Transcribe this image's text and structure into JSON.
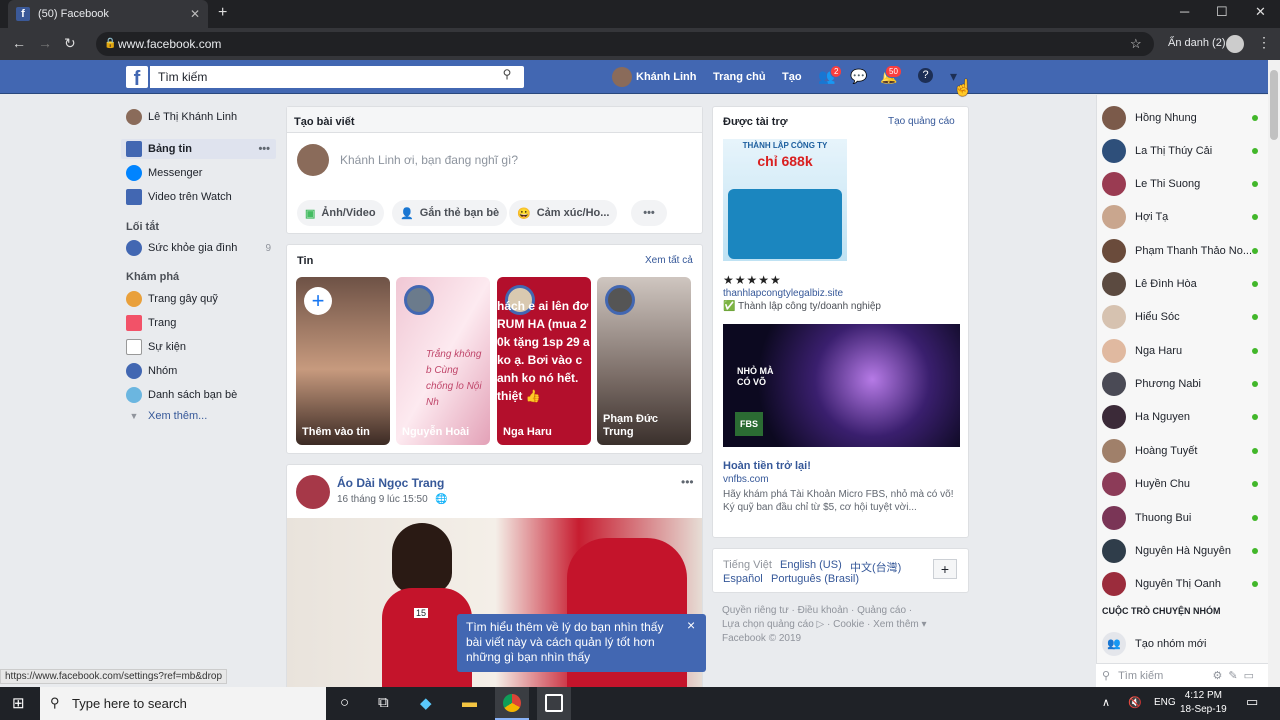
{
  "browser": {
    "tab_title": "(50) Facebook",
    "url": "www.facebook.com",
    "incognito_label": "Ẩn danh (2)",
    "status_url": "https://www.facebook.com/settings?ref=mb&drop"
  },
  "fb_header": {
    "search_placeholder": "Tìm kiếm",
    "user_name": "Khánh Linh",
    "home": "Trang chủ",
    "create": "Tạo",
    "friend_badge": "2",
    "notif_badge": "50"
  },
  "left_nav": {
    "profile": "Lê Thị Khánh Linh",
    "items": [
      "Bảng tin",
      "Messenger",
      "Video trên Watch"
    ],
    "shortcuts_title": "Lối tắt",
    "shortcut": "Sức khỏe gia đình",
    "shortcut_count": "9",
    "explore_title": "Khám phá",
    "explore": [
      "Trang gây quỹ",
      "Trang",
      "Sự kiện",
      "Nhóm",
      "Danh sách bạn bè"
    ],
    "see_more": "Xem thêm..."
  },
  "composer": {
    "title": "Tạo bài viết",
    "placeholder": "Khánh Linh ơi, bạn đang nghĩ gì?",
    "photo": "Ảnh/Video",
    "tag": "Gắn thẻ bạn bè",
    "feeling": "Cảm xúc/Ho...",
    "more": "•••"
  },
  "stories": {
    "title": "Tin",
    "see_all": "Xem tất cả",
    "items": [
      "Thêm vào tin",
      "Nguyễn Hoài",
      "Nga Haru",
      "Phạm Đức Trung"
    ],
    "story2_text": "Trắng không b Cùng chống lo Nội Nh",
    "story3_text": "hách e ai lên đơ RUM HA (mua 2 0k tặng 1sp 29 a ko ạ. Bơi vào c anh ko nó hết. thiệt 👍"
  },
  "post": {
    "author": "Áo Dài Ngọc Trang",
    "time": "16 tháng 9 lúc 15:50",
    "more": "•••",
    "tag": "15"
  },
  "tooltip": {
    "text": "Tìm hiểu thêm về lý do bạn nhìn thấy bài viết này và cách quản lý tốt hơn những gì bạn nhìn thấy",
    "close": "×"
  },
  "sponsored": {
    "title": "Được tài trợ",
    "create_ad": "Tạo quảng cáo",
    "ad1_img_top": "THÀNH LẬP CÔNG TY",
    "ad1_img_price": "chỉ 688k",
    "stars": "★★★★★",
    "ad1_site": "thanhlapcongtylegalbiz.site",
    "ad1_desc": "✅ Thành lập công ty/doanh nghiệp",
    "ad2_img_text": "NHỎ MÀ CÓ VÕ",
    "ad2_img_logo": "FBS",
    "ad2_title": "Hoàn tiền trở lại!",
    "ad2_site": "vnfbs.com",
    "ad2_desc": "Hãy khám phá Tài Khoản Micro FBS, nhỏ mà có võ! Ký quỹ ban đầu chỉ từ $5, cơ hội tuyệt vời..."
  },
  "languages": {
    "current": "Tiếng Việt",
    "list": [
      "English (US)",
      "中文(台灣)",
      "Español",
      "Português (Brasil)"
    ],
    "add": "+"
  },
  "footer": {
    "line1": "Quyền riêng tư · Điều khoản · Quảng cáo ·",
    "line2": "Lựa chọn quảng cáo ▷ · Cookie · Xem thêm ▾",
    "line3": "Facebook © 2019"
  },
  "chat": {
    "contacts": [
      "Hồng Nhung",
      "La Thị Thúy Cải",
      "Le Thi Suong",
      "Hợi Tạ",
      "Phạm Thanh Thảo No...",
      "Lê Đình Hòa",
      "Hiểu Sóc",
      "Nga Haru",
      "Phương Nabi",
      "Ha Nguyen",
      "Hoàng Tuyết",
      "Huyền Chu",
      "Thuong Bui",
      "Nguyễn Hà Nguyễn",
      "Nguyễn Thị Oanh"
    ],
    "group_title": "CUỘC TRÒ CHUYỆN NHÓM",
    "create_group": "Tạo nhóm mới",
    "search": "Tìm kiếm"
  },
  "taskbar": {
    "search": "Type here to search",
    "lang": "ENG",
    "time": "4:12 PM",
    "date": "18-Sep-19"
  }
}
